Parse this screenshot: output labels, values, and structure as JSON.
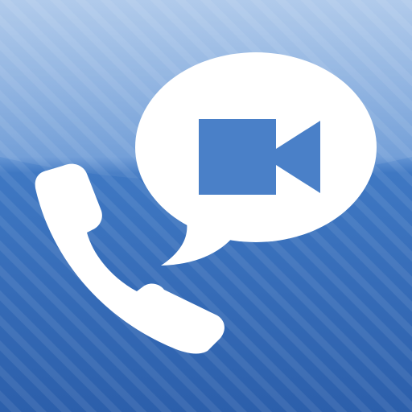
{
  "icon": {
    "name": "video-call-app-icon",
    "symbols": [
      "phone-handset-icon",
      "speech-bubble-icon",
      "video-camera-icon"
    ],
    "colors": {
      "background_top": "#7fa8d9",
      "background_mid": "#4a80c8",
      "background_bottom": "#2f63ad",
      "stripe": "#ffffff",
      "glyph": "#ffffff",
      "glyph_cutout": "#4a80c8"
    }
  }
}
